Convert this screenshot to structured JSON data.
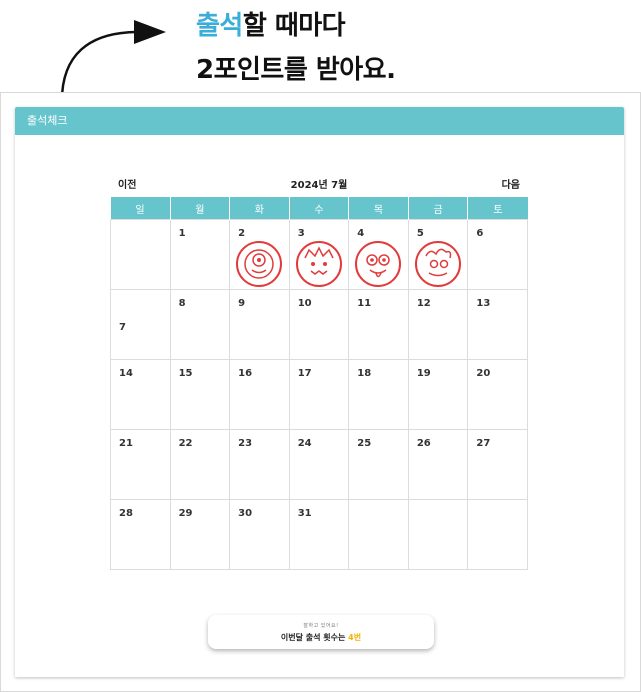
{
  "callout": {
    "accent": "출석",
    "line1_rest": "할 때마다",
    "line2": "2포인트를 받아요."
  },
  "panel": {
    "title": "출석체크"
  },
  "calendar": {
    "prev_label": "이전",
    "month_label": "2024년 7월",
    "next_label": "다음",
    "weekdays": [
      "일",
      "월",
      "화",
      "수",
      "목",
      "금",
      "토"
    ],
    "stamped_days": [
      2,
      3,
      4,
      5
    ]
  },
  "summary": {
    "subtitle": "잘하고 있어요!",
    "prefix": "이번달 출석 횟수는 ",
    "count": "4번"
  },
  "colors": {
    "header": "#66c4cc",
    "accent": "#3aaed8",
    "stamp": "#e23b3b",
    "count": "#f0b400"
  }
}
